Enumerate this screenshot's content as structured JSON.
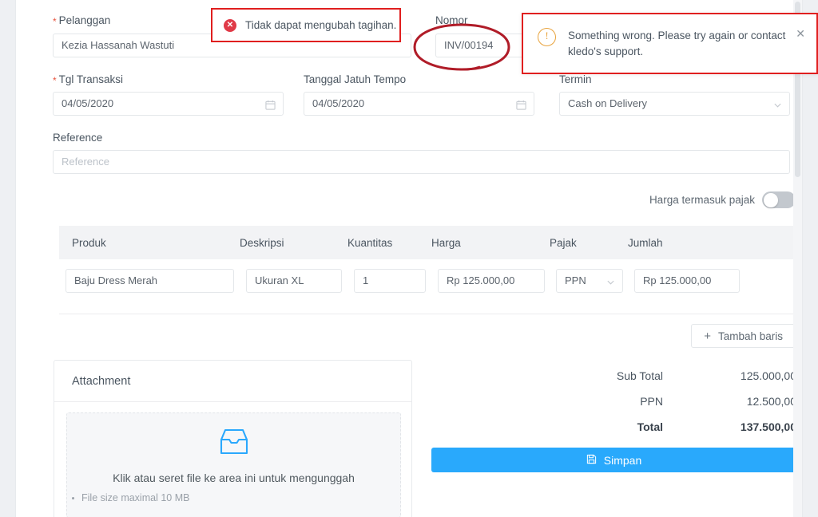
{
  "form": {
    "customer": {
      "label": "Pelanggan",
      "required": true,
      "value": "Kezia Hassanah Wastuti"
    },
    "number": {
      "label": "Nomor",
      "required": false,
      "value": "INV/00194"
    },
    "transaction_date": {
      "label": "Tgl Transaksi",
      "required": true,
      "value": "04/05/2020",
      "icon": "calendar-icon"
    },
    "due_date": {
      "label": "Tanggal Jatuh Tempo",
      "required": false,
      "value": "04/05/2020",
      "icon": "calendar-icon"
    },
    "term": {
      "label": "Termin",
      "value": "Cash on Delivery",
      "icon": "chevron-down-icon"
    },
    "reference": {
      "label": "Reference",
      "value": "",
      "placeholder": "Reference"
    },
    "tax_inclusive_toggle": {
      "label": "Harga termasuk pajak",
      "state": "off"
    }
  },
  "items_table": {
    "headers": {
      "product": "Produk",
      "description": "Deskripsi",
      "quantity": "Kuantitas",
      "price": "Harga",
      "tax": "Pajak",
      "amount": "Jumlah"
    },
    "rows": [
      {
        "product": "Baju Dress Merah",
        "description": "Ukuran XL",
        "quantity": "1",
        "price": "Rp 125.000,00",
        "tax": "PPN",
        "amount": "Rp 125.000,00"
      }
    ],
    "add_row_button": {
      "label": "Tambah baris",
      "icon": "plus-icon"
    }
  },
  "attachment": {
    "title": "Attachment",
    "dropzone_icon": "inbox-icon",
    "dropzone_text": "Klik atau seret file ke area ini untuk mengunggah",
    "dropzone_hint": "File size maximal 10 MB"
  },
  "totals": {
    "lines": [
      {
        "label": "Sub Total",
        "value": "125.000,00"
      },
      {
        "label": "PPN",
        "value": "12.500,00"
      },
      {
        "label": "Total",
        "value": "137.500,00"
      }
    ]
  },
  "save_button": {
    "label": "Simpan",
    "icon": "save-icon"
  },
  "inline_error": {
    "icon": "error-circle-icon",
    "text": "Tidak dapat mengubah tagihan."
  },
  "toast": {
    "icon": "warning-circle-icon",
    "message": "Something wrong. Please try again or contact kledo's support.",
    "close_icon": "close-icon"
  },
  "colors": {
    "accent": "#29a9fc",
    "error_border": "#e01f1f",
    "error_icon": "#e03a47",
    "warning_icon": "#e8a33d",
    "annotation": "#b01c28",
    "table_header_bg": "#f2f3f5",
    "required_star": "#e8543f"
  }
}
